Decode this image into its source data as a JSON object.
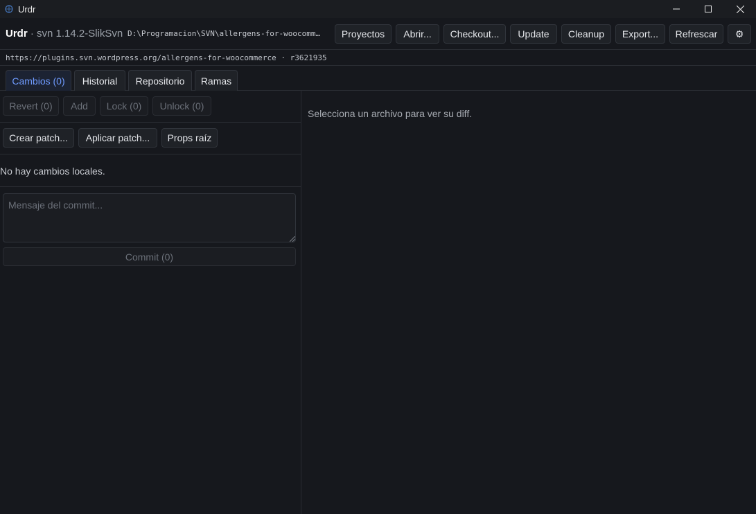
{
  "window": {
    "title": "Urdr",
    "controls": {
      "minimize": "—",
      "maximize": "☐",
      "close": "✕"
    }
  },
  "header": {
    "app_name": "Urdr",
    "version": " · svn 1.14.2-SlikSvn",
    "path": "D:\\Programacion\\SVN\\allergens-for-woocomm…",
    "buttons": {
      "proyectos": "Proyectos",
      "abrir": "Abrir...",
      "checkout": "Checkout...",
      "update": "Update",
      "cleanup": "Cleanup",
      "export": "Export...",
      "refrescar": "Refrescar",
      "settings": "⚙"
    }
  },
  "repo": {
    "url_line": "https://plugins.svn.wordpress.org/allergens-for-woocommerce · r3621935"
  },
  "tabs": [
    {
      "label": "Cambios (0)",
      "active": true
    },
    {
      "label": "Historial",
      "active": false
    },
    {
      "label": "Repositorio",
      "active": false
    },
    {
      "label": "Ramas",
      "active": false
    }
  ],
  "changes": {
    "actions": {
      "revert": "Revert (0)",
      "add": "Add",
      "lock": "Lock (0)",
      "unlock": "Unlock (0)"
    },
    "patch": {
      "create": "Crear patch...",
      "apply": "Aplicar patch...",
      "props": "Props raíz"
    },
    "empty_message": "No hay cambios locales.",
    "commit_placeholder": "Mensaje del commit...",
    "commit_value": "",
    "commit_button": "Commit (0)"
  },
  "diff": {
    "empty_message": "Selecciona un archivo para ver su diff."
  },
  "colors": {
    "background": "#16181d",
    "accent": "#6f9bff",
    "border": "#2a2d33"
  }
}
